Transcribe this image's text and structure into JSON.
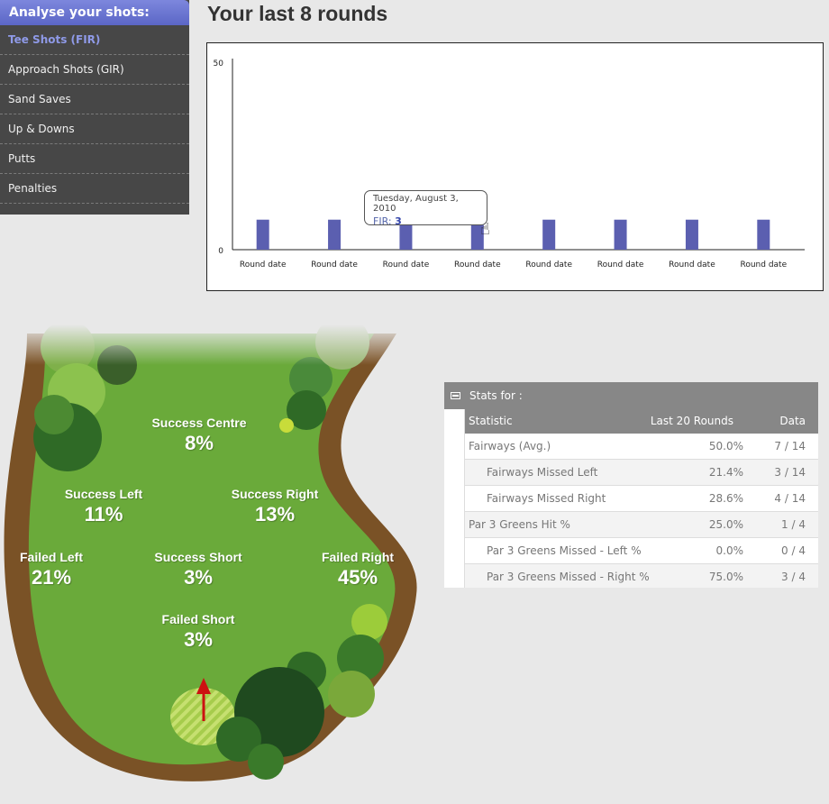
{
  "sidebar": {
    "header": "Analyse your shots:",
    "items": [
      {
        "label": "Tee Shots (FIR)",
        "active": true
      },
      {
        "label": "Approach Shots (GIR)",
        "active": false
      },
      {
        "label": "Sand Saves",
        "active": false
      },
      {
        "label": "Up & Downs",
        "active": false
      },
      {
        "label": "Putts",
        "active": false
      },
      {
        "label": "Penalties",
        "active": false
      }
    ]
  },
  "page": {
    "title": "Your last 8 rounds"
  },
  "chart_data": {
    "type": "bar",
    "categories": [
      "Round date",
      "Round date",
      "Round date",
      "Round date",
      "Round date",
      "Round date",
      "Round date",
      "Round date"
    ],
    "values": [
      8,
      8,
      8,
      8,
      8,
      8,
      8,
      8
    ],
    "ylim": [
      0,
      50
    ],
    "yticks": [
      "50",
      "0"
    ],
    "bar_color": "#5b5fb0",
    "tooltip": {
      "date": "Tuesday, August 3, 2010",
      "label": "FIR:",
      "value": "3"
    }
  },
  "hole": {
    "zones": {
      "success_centre": {
        "label": "Success Centre",
        "value": "8%"
      },
      "success_left": {
        "label": "Success Left",
        "value": "11%"
      },
      "success_right": {
        "label": "Success Right",
        "value": "13%"
      },
      "failed_left": {
        "label": "Failed Left",
        "value": "21%"
      },
      "success_short": {
        "label": "Success Short",
        "value": "3%"
      },
      "failed_right": {
        "label": "Failed Right",
        "value": "45%"
      },
      "failed_short": {
        "label": "Failed Short",
        "value": "3%"
      }
    },
    "colors": {
      "fairway": "#6aaa3a",
      "rough": "#7a5226",
      "tee": "#b6d45a",
      "arrow": "#cc1111"
    }
  },
  "stats": {
    "header": "Stats for :",
    "columns": {
      "statistic": "Statistic",
      "last20": "Last 20 Rounds",
      "data": "Data"
    },
    "rows": [
      {
        "name": "Fairways (Avg.)",
        "pct": "50.0%",
        "data": "7 / 14",
        "indent": false
      },
      {
        "name": "Fairways Missed Left",
        "pct": "21.4%",
        "data": "3 / 14",
        "indent": true
      },
      {
        "name": "Fairways Missed Right",
        "pct": "28.6%",
        "data": "4 / 14",
        "indent": true
      },
      {
        "name": "Par 3 Greens Hit %",
        "pct": "25.0%",
        "data": "1 / 4",
        "indent": false
      },
      {
        "name": "Par 3 Greens Missed - Left %",
        "pct": "0.0%",
        "data": "0 / 4",
        "indent": true
      },
      {
        "name": "Par 3 Greens Missed - Right %",
        "pct": "75.0%",
        "data": "3 / 4",
        "indent": true
      }
    ]
  }
}
